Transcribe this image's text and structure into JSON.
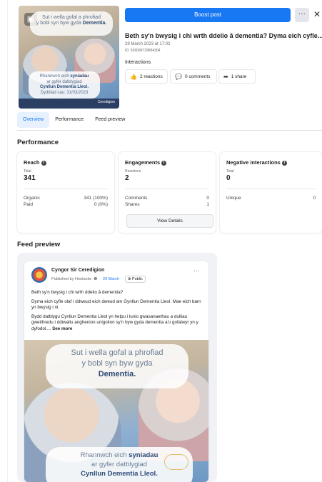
{
  "thumbnail": {
    "quote_top_line1": "Sut i wella gofal a phrofiad",
    "quote_top_line2": "y bobl syn byw gyda",
    "quote_top_bold": "Dementia.",
    "quote_bottom_line1": "Rhannwch eich",
    "quote_bottom_bold1": "syniadau",
    "quote_bottom_line2": "ar gyfer datblygiad",
    "quote_bottom_bold2": "Cynllun Dementia Lleol.",
    "deadline": "Dyddiad cau: 31/03/2023",
    "logo_text": "Ceredigion",
    "icon": "image-icon"
  },
  "header": {
    "boost_label": "Boost post",
    "more_label": "···",
    "close_label": "✕",
    "post_title": "Beth sy'n bwysig i chi wrth ddelio â dementia? Dyma eich cyfle...",
    "post_date": "29 March 2023 at 17:02",
    "post_id": "ID: 526099729894304",
    "interactions_label": "Interactions",
    "reactions": "2 reactions",
    "comments": "0 comments",
    "shares": "1 share"
  },
  "tabs": [
    {
      "label": "Overview",
      "active": true
    },
    {
      "label": "Performance",
      "active": false
    },
    {
      "label": "Feed preview",
      "active": false
    }
  ],
  "performance": {
    "title": "Performance",
    "reach": {
      "title": "Reach",
      "sub": "Total",
      "value": "341",
      "rows": [
        {
          "label": "Organic",
          "value": "341 (100%)"
        },
        {
          "label": "Paid",
          "value": "0 (0%)"
        }
      ]
    },
    "engagements": {
      "title": "Engagements",
      "sub": "Reactions",
      "value": "2",
      "rows": [
        {
          "label": "Comments",
          "value": "0"
        },
        {
          "label": "Shares",
          "value": "1"
        }
      ],
      "button": "View Details"
    },
    "negative": {
      "title": "Negative interactions",
      "sub": "Total",
      "value": "0",
      "rows": [
        {
          "label": "Unique",
          "value": "0"
        }
      ]
    }
  },
  "feed_preview": {
    "title": "Feed preview",
    "page_name": "Cyngor Sir Ceredigion",
    "published_by": "Published by Hootsuite",
    "date": "29 March",
    "visibility": "Public",
    "menu": "···",
    "paragraph1": "Beth sy'n bwysig i chi wrth ddelio â dementia?",
    "paragraph2": "Dyma eich cyfle olaf i ddweud eich dweud am Gynllun Dementia Lleol. Mae eich barn yn bwysig i ni.",
    "paragraph3": "Bydd datblygu Cynllun Dementia Lleol yn helpu i lunio gwasanaethau a dulliau gweithredu i ddiwallu anghenion unigolion sy'n byw gyda dementia a'u gofalwyr yn y dyfodol....",
    "see_more": "See more",
    "image_top_line1": "Sut i wella gofal a phrofiad",
    "image_top_line2": "y bobl syn byw gyda",
    "image_top_bold": "Dementia.",
    "image_bottom_line1": "Rhannwch eich",
    "image_bottom_bold1": "syniadau",
    "image_bottom_line2": "ar gyfer datblygiad",
    "image_bottom_bold2": "Cynllun Dementia Lleol."
  }
}
